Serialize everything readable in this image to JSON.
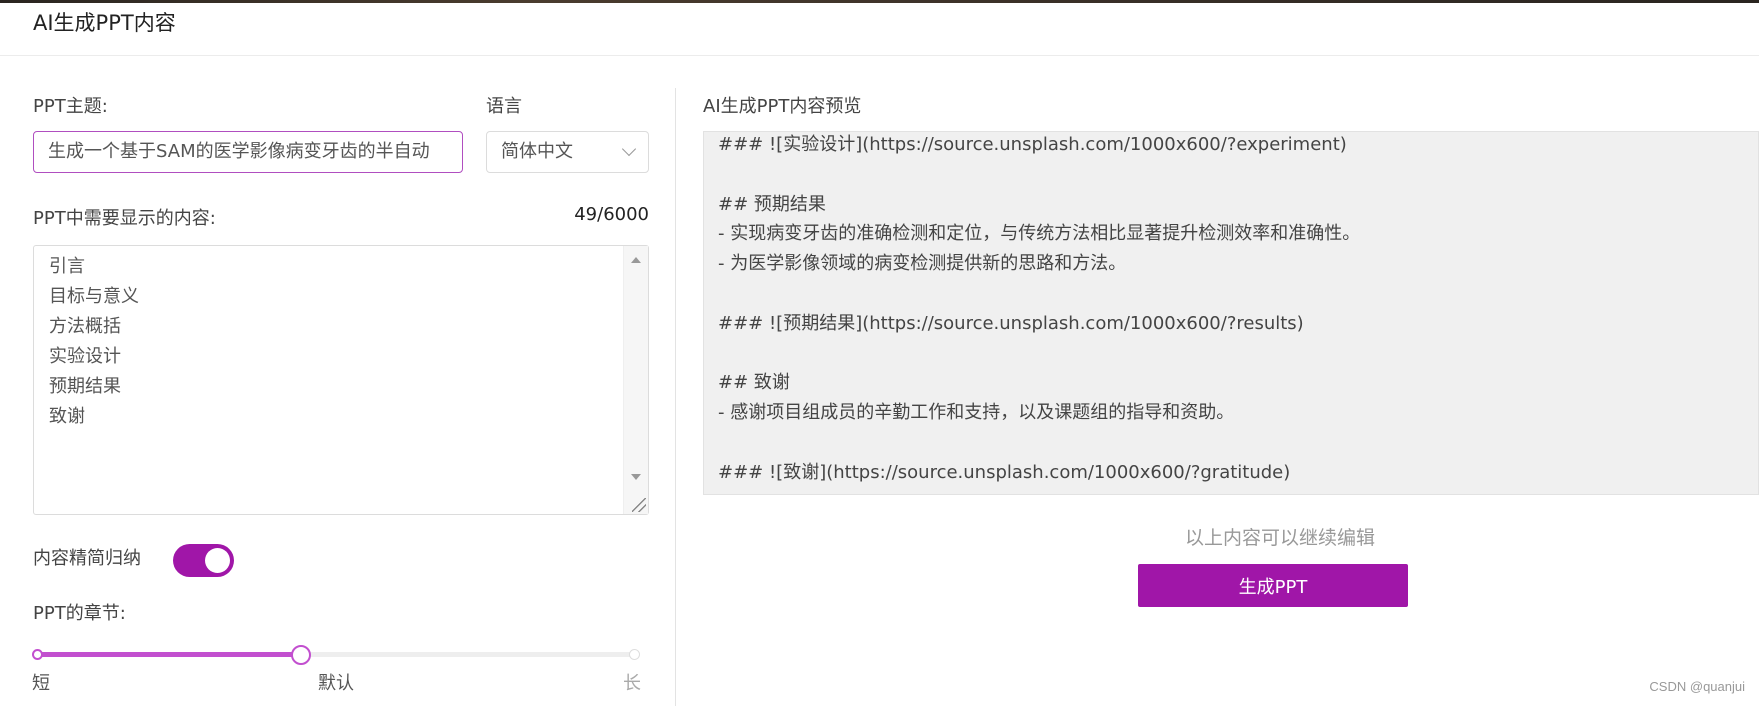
{
  "header": {
    "title": "AI生成PPT内容"
  },
  "form": {
    "topic_label": "PPT主题:",
    "topic_value": "生成一个基于SAM的医学影像病变牙齿的半自动",
    "language_label": "语言",
    "language_value": "简体中文",
    "content_label": "PPT中需要显示的内容:",
    "char_count": "49/6000",
    "content_lines": [
      "引言",
      "目标与意义",
      "方法概括",
      "实验设计",
      "预期结果",
      "致谢"
    ],
    "summarize_label": "内容精简归纳",
    "summarize_on": true,
    "chapters_label": "PPT的章节:",
    "chapter_slider": {
      "labels": {
        "short": "短",
        "default": "默认",
        "long": "长"
      },
      "value": 0.5
    }
  },
  "preview": {
    "label": "AI生成PPT内容预览",
    "lines": [
      "### ![实验设计](https://source.unsplash.com/1000x600/?experiment)",
      "",
      "## 预期结果",
      "- 实现病变牙齿的准确检测和定位，与传统方法相比显著提升检测效率和准确性。",
      "- 为医学影像领域的病变检测提供新的思路和方法。",
      "",
      "### ![预期结果](https://source.unsplash.com/1000x600/?results)",
      "",
      "## 致谢",
      "- 感谢项目组成员的辛勤工作和支持，以及课题组的指导和资助。",
      "",
      "### ![致谢](https://source.unsplash.com/1000x600/?gratitude)"
    ],
    "edit_hint": "以上内容可以继续编辑",
    "generate_button": "生成PPT"
  },
  "watermark": "CSDN @quanjui",
  "colors": {
    "accent": "#a016a8",
    "slider_fill": "#c24fcf"
  }
}
